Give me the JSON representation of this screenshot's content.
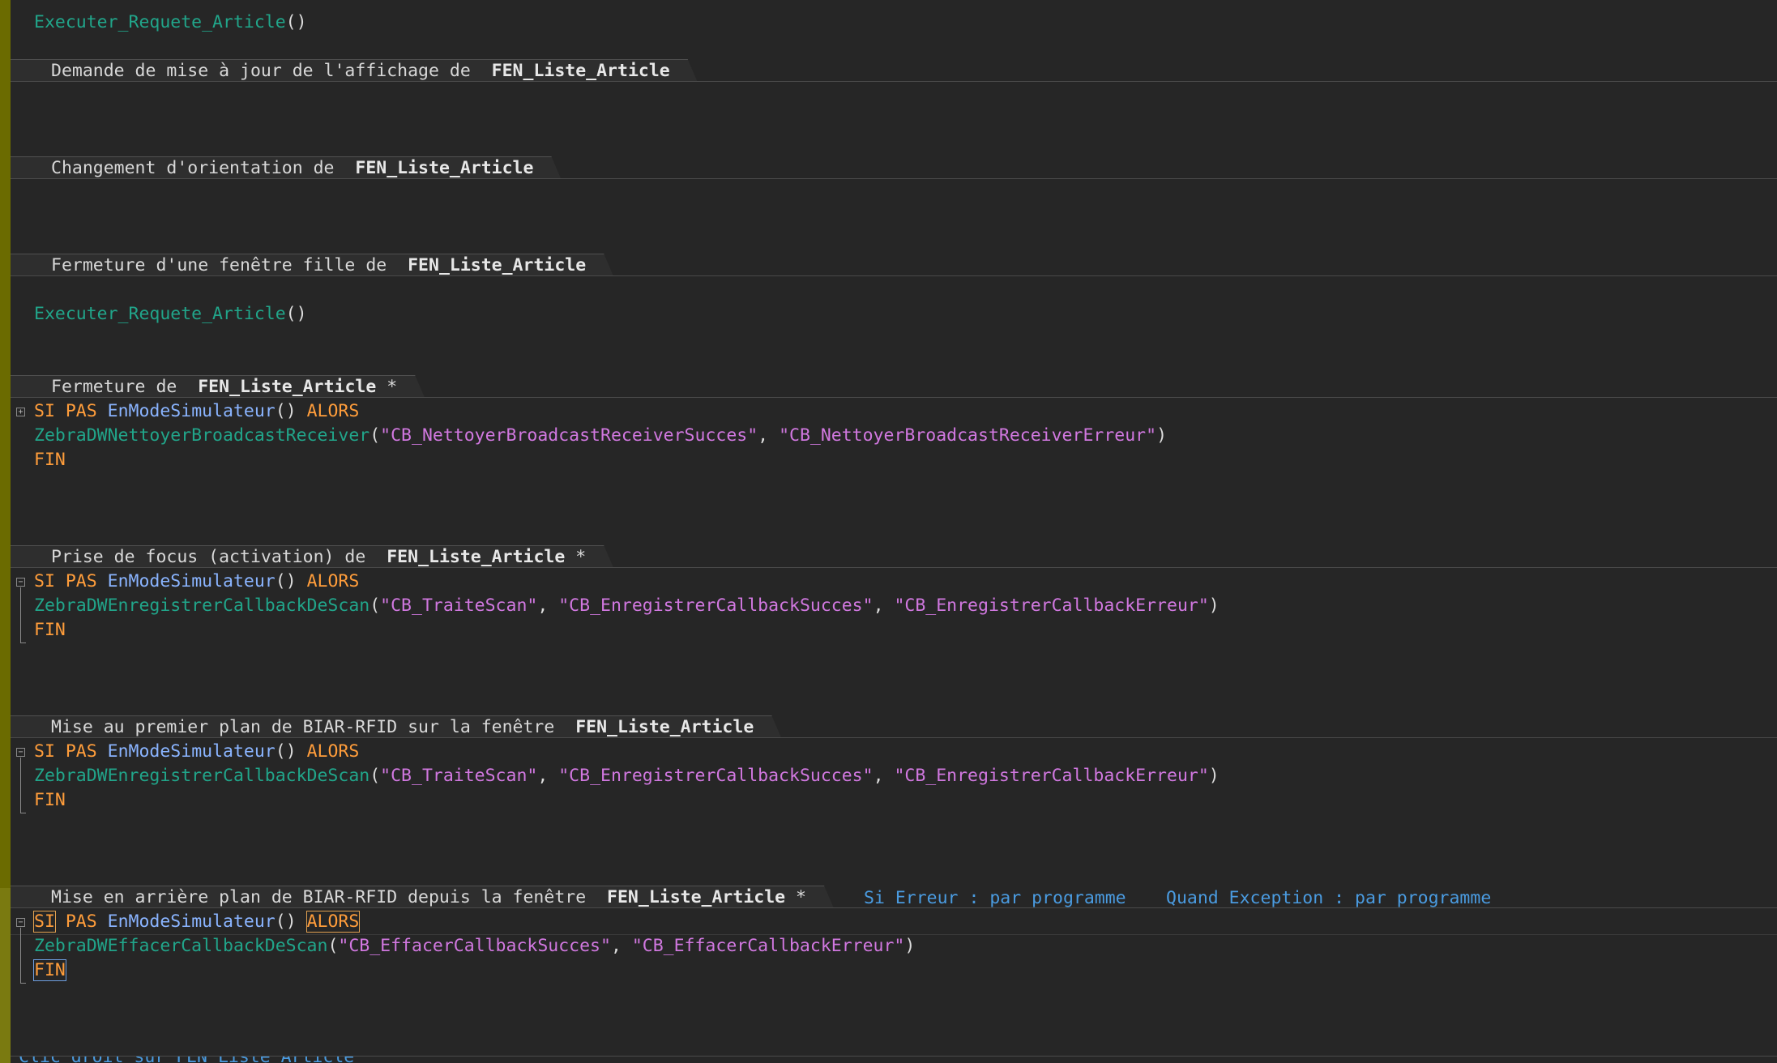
{
  "colors": {
    "gutter": "#6b6b00",
    "function": "#21a58a",
    "keyword": "#ff9d3b",
    "call": "#8ab4ff",
    "string": "#d178e0",
    "link": "#4a9be0"
  },
  "sections": {
    "init": {
      "call": "Executer_Requete_Article",
      "parens": "()"
    },
    "s1": {
      "title": "Demande de mise à jour de l'affichage de ",
      "target": "FEN_Liste_Article"
    },
    "s2": {
      "title": "Changement d'orientation de ",
      "target": "FEN_Liste_Article"
    },
    "s3": {
      "title": "Fermeture d'une fenêtre fille de ",
      "target": "FEN_Liste_Article",
      "call": "Executer_Requete_Article",
      "parens": "()"
    },
    "s4": {
      "title": "Fermeture de ",
      "target": "FEN_Liste_Article",
      "star": " *",
      "kw_si": "SI",
      "kw_pas": "PAS",
      "cond": "EnModeSimulateur",
      "cond_parens": "()",
      "kw_alors": "ALORS",
      "fn": "ZebraDWNettoyerBroadcastReceiver",
      "arg1": "\"CB_NettoyerBroadcastReceiverSucces\"",
      "arg2": "\"CB_NettoyerBroadcastReceiverErreur\"",
      "kw_fin": "FIN"
    },
    "s5": {
      "title": "Prise de focus (activation) de ",
      "target": "FEN_Liste_Article",
      "star": " *",
      "kw_si": "SI",
      "kw_pas": "PAS",
      "cond": "EnModeSimulateur",
      "cond_parens": "()",
      "kw_alors": "ALORS",
      "fn": "ZebraDWEnregistrerCallbackDeScan",
      "arg1": "\"CB_TraiteScan\"",
      "arg2": "\"CB_EnregistrerCallbackSucces\"",
      "arg3": "\"CB_EnregistrerCallbackErreur\"",
      "kw_fin": "FIN"
    },
    "s6": {
      "title": "Mise au premier plan de BIAR-RFID sur la fenêtre ",
      "target": "FEN_Liste_Article",
      "kw_si": "SI",
      "kw_pas": "PAS",
      "cond": "EnModeSimulateur",
      "cond_parens": "()",
      "kw_alors": "ALORS",
      "fn": "ZebraDWEnregistrerCallbackDeScan",
      "arg1": "\"CB_TraiteScan\"",
      "arg2": "\"CB_EnregistrerCallbackSucces\"",
      "arg3": "\"CB_EnregistrerCallbackErreur\"",
      "kw_fin": "FIN"
    },
    "s7": {
      "title": "Mise en arrière plan de BIAR-RFID depuis la fenêtre ",
      "target": "FEN_Liste_Article",
      "star": " *",
      "on_error": "Si Erreur : par programme",
      "on_exception": "Quand Exception : par programme",
      "kw_si": "SI",
      "kw_pas": "PAS",
      "cond": "EnModeSimulateur",
      "cond_parens": "()",
      "kw_alors": "ALORS",
      "fn": "ZebraDWEffacerCallbackDeScan",
      "arg1": "\"CB_EffacerCallbackSucces\"",
      "arg2": "\"CB_EffacerCallbackErreur\"",
      "kw_fin": "FIN"
    },
    "s8": {
      "title": "Clic droit sur FEN_Liste_Article"
    }
  },
  "fold": {
    "plus": "+",
    "minus": "−"
  }
}
